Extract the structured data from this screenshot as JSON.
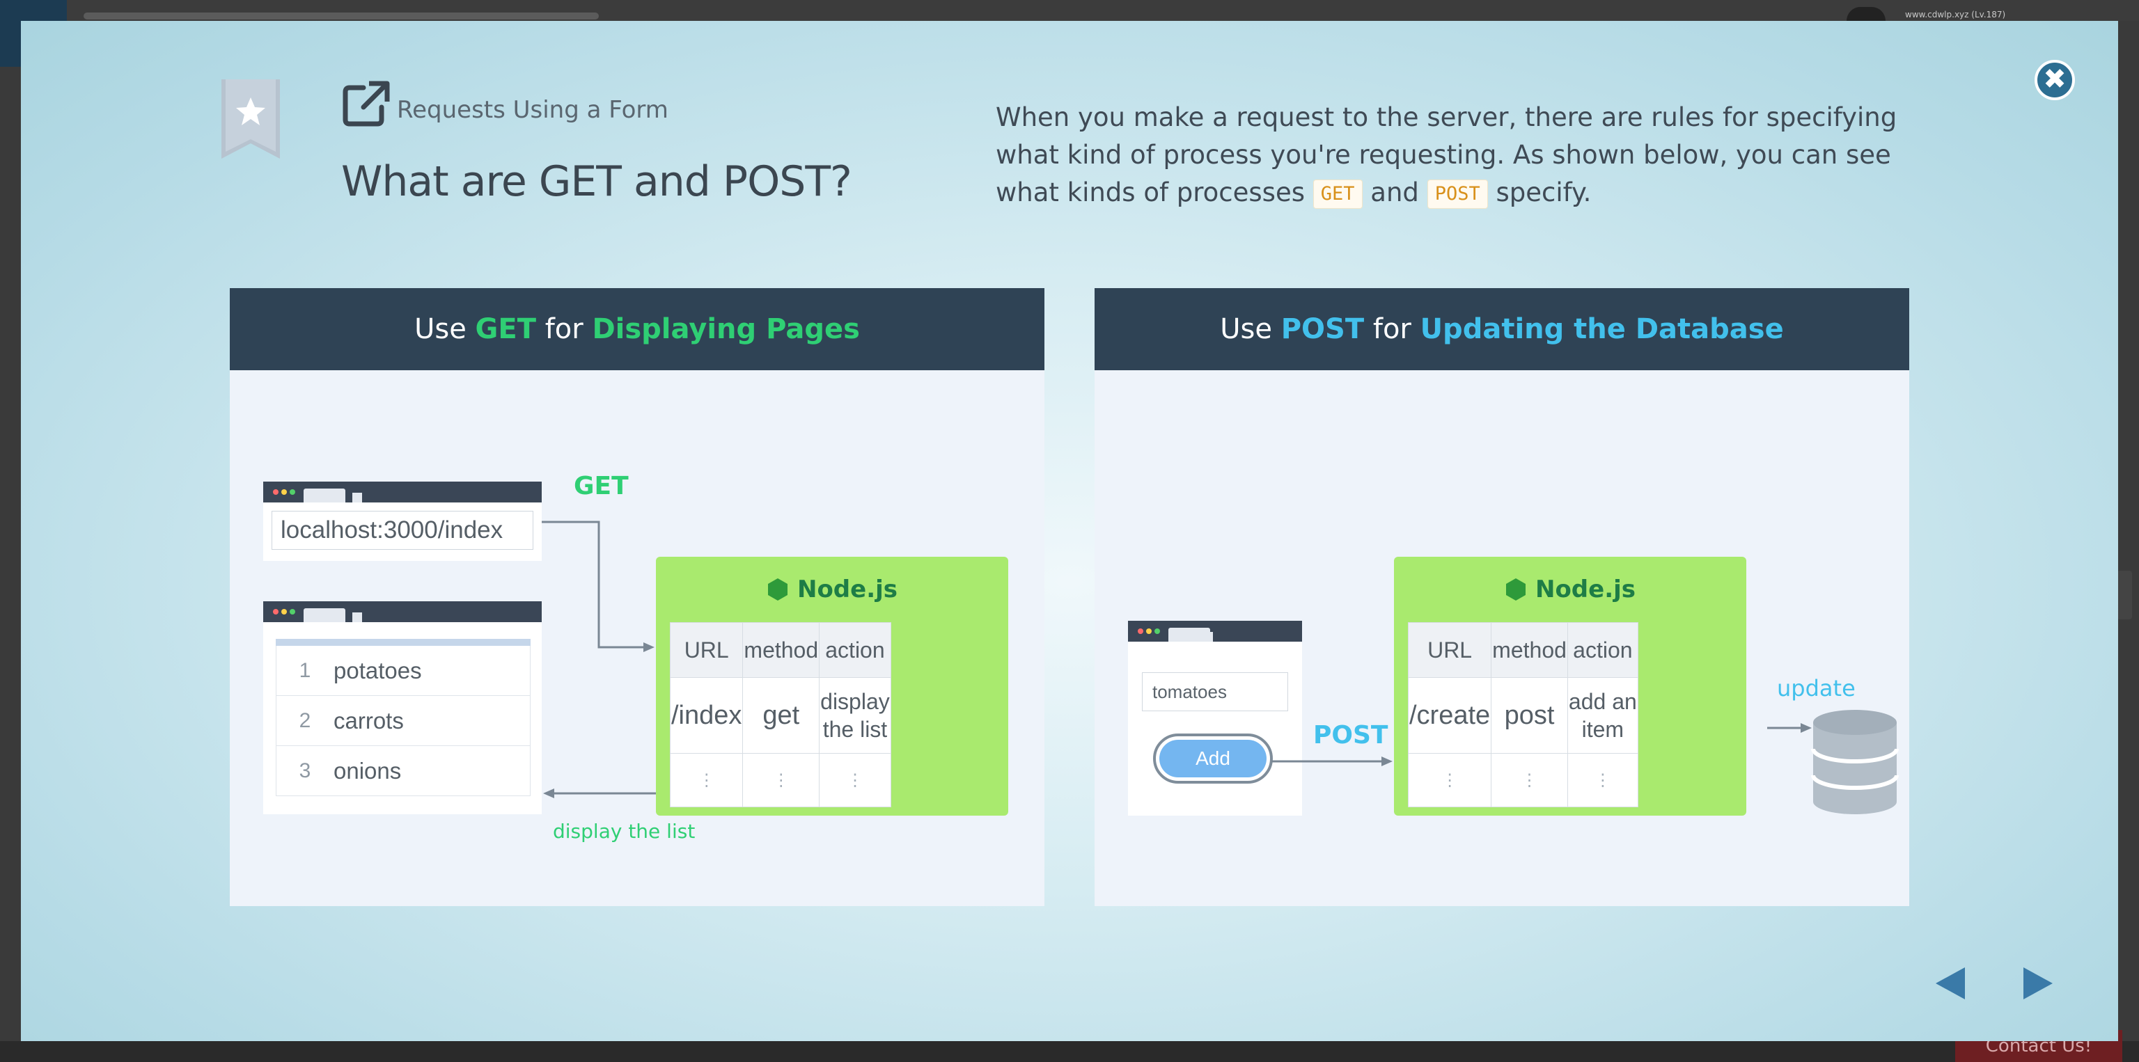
{
  "background": {
    "url_text": "www.cdwlp.xyz (Lv.187)",
    "contact_label": "Contact Us!"
  },
  "dialog": {
    "eyebrow": "Requests Using a Form",
    "title": "What are GET and POST?",
    "description": {
      "part1": "When you make a request to the server, there are rules for specifying what kind of process you're requesting. As shown below, you can see what kinds of processes",
      "code1": "GET",
      "and": "and",
      "code2": "POST",
      "part2": "specify."
    },
    "panels": {
      "get": {
        "header": {
          "pre": "Use",
          "method": "GET",
          "mid": "for",
          "purpose": "Displaying Pages"
        },
        "browser_url": "localhost:3000/index",
        "get_label": "GET",
        "list": [
          {
            "num": "1",
            "item": "potatoes"
          },
          {
            "num": "2",
            "item": "carrots"
          },
          {
            "num": "3",
            "item": "onions"
          }
        ],
        "server_label": "Node.js",
        "table_headers": [
          "URL",
          "method",
          "action"
        ],
        "row": {
          "url": "/index",
          "method": "get",
          "action_line1": "display",
          "action_line2": "the list"
        },
        "dots": "⋮",
        "display_label": "display the list"
      },
      "post": {
        "header": {
          "pre": "Use",
          "method": "POST",
          "mid": "for",
          "purpose": "Updating the Database"
        },
        "form_value": "tomatoes",
        "add_button": "Add",
        "post_label": "POST",
        "server_label": "Node.js",
        "table_headers": [
          "URL",
          "method",
          "action"
        ],
        "row": {
          "url": "/create",
          "method": "post",
          "action_line1": "add an",
          "action_line2": "item"
        },
        "dots": "⋮",
        "update_label": "update"
      }
    }
  },
  "icons": {
    "close": "close-icon",
    "bookmark": "bookmark-star-icon",
    "external": "external-link-icon",
    "prev": "previous-arrow-icon",
    "next": "next-arrow-icon",
    "database": "database-icon",
    "nodejs": "nodejs-hexagon-icon"
  },
  "colors": {
    "header_bg": "#2f4355",
    "get_green": "#2fcf74",
    "post_blue": "#42c0ec",
    "server_green": "#a9ea6e",
    "close_button": "#2c6e92",
    "nav_arrow": "#3a7aa8"
  }
}
